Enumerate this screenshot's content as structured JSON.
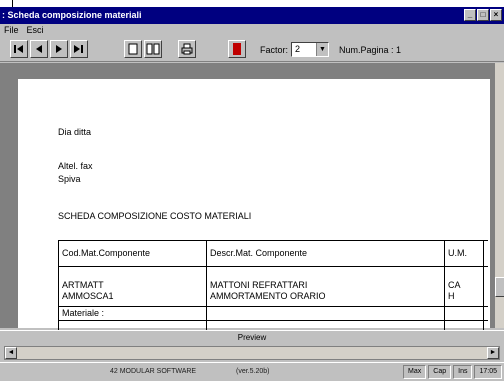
{
  "window": {
    "title": ": Scheda composizione materiali"
  },
  "menu": {
    "items": [
      "File",
      "Esci"
    ]
  },
  "toolbar": {
    "factor_label": "Factor:",
    "factor_value": "2",
    "num_pagine_label": "Num.Pagina : 1"
  },
  "document": {
    "company_line": "Dia ditta",
    "contact_line1": "Altel. fax",
    "contact_line2": "Spiva",
    "heading": "SCHEDA COMPOSIZIONE COSTO MATERIALI",
    "table": {
      "headers": [
        "Cod.Mat.Componente",
        "Descr.Mat. Componente",
        "U.M."
      ],
      "rows": [
        [
          "ARTMATT",
          "MATTONI REFRATTARI",
          "CA"
        ],
        [
          "AMMOSCA1",
          "AMMORTAMENTO ORARIO",
          "H"
        ]
      ],
      "footer_label": "Materiale :"
    }
  },
  "status": {
    "label": "Preview"
  },
  "taskbar": {
    "center_text": "42 MODULAR SOFTWARE",
    "version_text": "(ver.5.20b)",
    "tray": [
      "Max",
      "Cap",
      "Ins",
      "17:05"
    ]
  }
}
